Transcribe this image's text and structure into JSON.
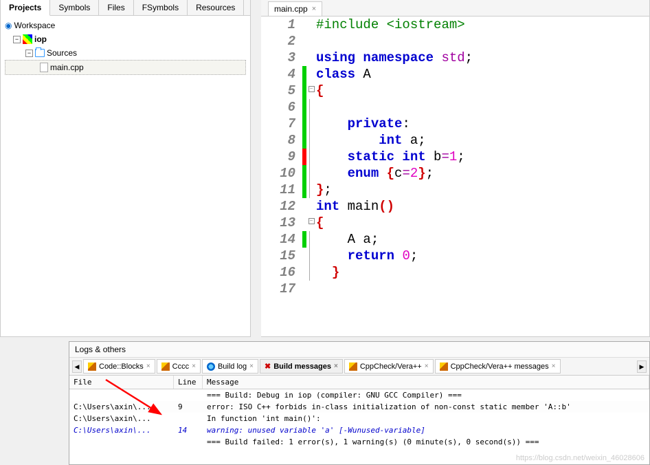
{
  "project_tabs": [
    "Projects",
    "Symbols",
    "Files",
    "FSymbols",
    "Resources"
  ],
  "active_project_tab": 0,
  "tree": {
    "workspace": "Workspace",
    "project": "iop",
    "sources": "Sources",
    "file": "main.cpp"
  },
  "editor_tab": "main.cpp",
  "code_lines": [
    {
      "n": 1,
      "change": "",
      "fold": "",
      "t": [
        [
          "g",
          "#include "
        ],
        [
          "g",
          "<iostream>"
        ]
      ]
    },
    {
      "n": 2,
      "change": "",
      "fold": "",
      "t": [
        [
          "k",
          ""
        ]
      ]
    },
    {
      "n": 3,
      "change": "",
      "fold": "",
      "t": [
        [
          "b",
          "using "
        ],
        [
          "b",
          "namespace "
        ],
        [
          "p",
          "std"
        ],
        [
          "k",
          ";"
        ]
      ]
    },
    {
      "n": 4,
      "change": "green",
      "fold": "",
      "t": [
        [
          "b",
          "class "
        ],
        [
          "k",
          "A"
        ]
      ]
    },
    {
      "n": 5,
      "change": "green",
      "fold": "box",
      "t": [
        [
          "r",
          "{"
        ]
      ]
    },
    {
      "n": 6,
      "change": "green",
      "fold": "line",
      "t": [
        [
          "k",
          ""
        ]
      ]
    },
    {
      "n": 7,
      "change": "green",
      "fold": "line",
      "t": [
        [
          "k",
          "    "
        ],
        [
          "b",
          "private"
        ],
        [
          "k",
          ":"
        ]
      ]
    },
    {
      "n": 8,
      "change": "green",
      "fold": "line",
      "t": [
        [
          "k",
          "        "
        ],
        [
          "b",
          "int "
        ],
        [
          "k",
          "a;"
        ]
      ]
    },
    {
      "n": 9,
      "change": "red",
      "fold": "line",
      "t": [
        [
          "k",
          "    "
        ],
        [
          "b",
          "static int "
        ],
        [
          "k",
          "b"
        ],
        [
          "p",
          "="
        ],
        [
          "m",
          "1"
        ],
        [
          "k",
          ";"
        ]
      ]
    },
    {
      "n": 10,
      "change": "green",
      "fold": "line",
      "t": [
        [
          "k",
          "    "
        ],
        [
          "b",
          "enum "
        ],
        [
          "r",
          "{"
        ],
        [
          "k",
          "c"
        ],
        [
          "p",
          "="
        ],
        [
          "m",
          "2"
        ],
        [
          "r",
          "}"
        ],
        [
          "k",
          ";"
        ]
      ]
    },
    {
      "n": 11,
      "change": "green",
      "fold": "end",
      "t": [
        [
          "r",
          "}"
        ],
        [
          "k",
          ";"
        ]
      ]
    },
    {
      "n": 12,
      "change": "",
      "fold": "",
      "t": [
        [
          "b",
          "int "
        ],
        [
          "k",
          "main"
        ],
        [
          "r",
          "()"
        ]
      ]
    },
    {
      "n": 13,
      "change": "",
      "fold": "box",
      "t": [
        [
          "r",
          "{"
        ]
      ]
    },
    {
      "n": 14,
      "change": "green",
      "fold": "line",
      "t": [
        [
          "k",
          "    A a;"
        ]
      ]
    },
    {
      "n": 15,
      "change": "",
      "fold": "line",
      "t": [
        [
          "k",
          "    "
        ],
        [
          "b",
          "return "
        ],
        [
          "m",
          "0"
        ],
        [
          "k",
          ";"
        ]
      ]
    },
    {
      "n": 16,
      "change": "",
      "fold": "end",
      "t": [
        [
          "k",
          "  "
        ],
        [
          "r",
          "}"
        ]
      ]
    },
    {
      "n": 17,
      "change": "",
      "fold": "",
      "t": [
        [
          "k",
          ""
        ]
      ]
    }
  ],
  "logs_title": "Logs & others",
  "log_tabs": [
    {
      "icon": "pencil",
      "label": "Code::Blocks"
    },
    {
      "icon": "pencil",
      "label": "Cccc"
    },
    {
      "icon": "blue",
      "label": "Build log"
    },
    {
      "icon": "red",
      "label": "Build messages"
    },
    {
      "icon": "pencil",
      "label": "CppCheck/Vera++"
    },
    {
      "icon": "pencil",
      "label": "CppCheck/Vera++ messages"
    }
  ],
  "active_log_tab": 3,
  "msg_headers": {
    "file": "File",
    "line": "Line",
    "msg": "Message"
  },
  "messages": [
    {
      "file": "",
      "line": "",
      "msg": "=== Build: Debug in iop (compiler: GNU GCC Compiler) ===",
      "cls": ""
    },
    {
      "file": "C:\\Users\\axin\\...",
      "line": "9",
      "msg": "error: ISO C++ forbids in-class initialization of non-const static member 'A::b'",
      "cls": "err"
    },
    {
      "file": "C:\\Users\\axin\\...",
      "line": "",
      "msg": "In function 'int main()':",
      "cls": ""
    },
    {
      "file": "C:\\Users\\axin\\...",
      "line": "14",
      "msg": "warning: unused variable 'a' [-Wunused-variable]",
      "cls": "blue"
    },
    {
      "file": "",
      "line": "",
      "msg": "=== Build failed: 1 error(s), 1 warning(s) (0 minute(s), 0 second(s)) ===",
      "cls": ""
    }
  ],
  "watermark": "https://blog.csdn.net/weixin_46028606"
}
